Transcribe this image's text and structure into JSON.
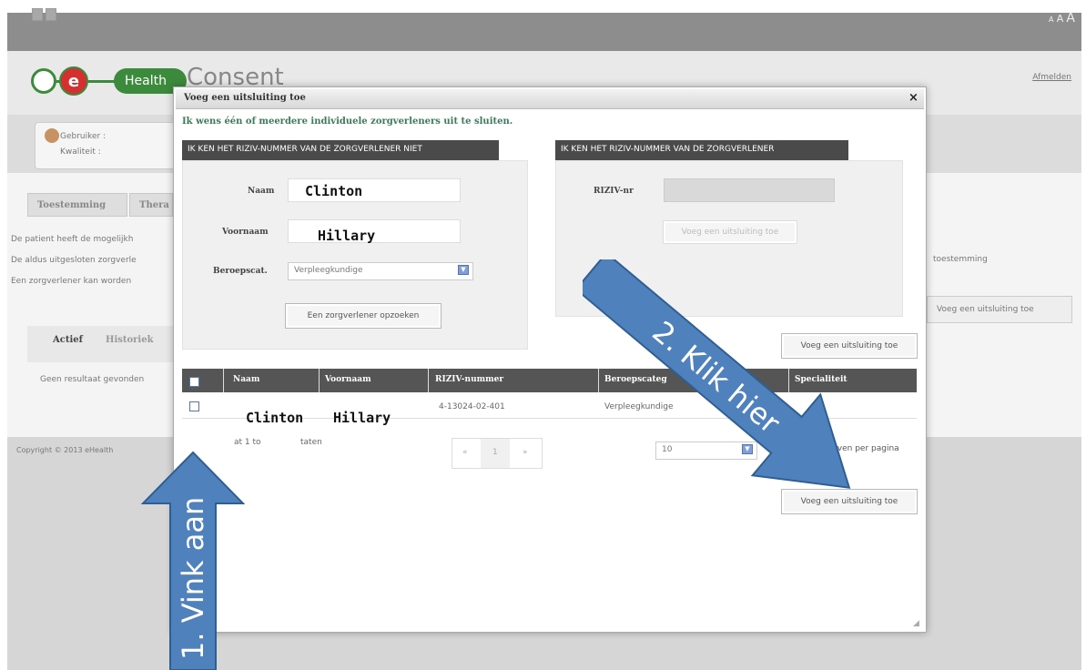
{
  "header": {
    "font_size_label": [
      "A",
      "A",
      "A"
    ],
    "logout_label": "Afmelden",
    "logo": {
      "e": "e",
      "health": "Health",
      "consent": "Consent"
    }
  },
  "user": {
    "line1": "Gebruiker :",
    "line2": "Kwaliteit :"
  },
  "main_tabs": [
    "Toestemming",
    "Thera"
  ],
  "info_lines": [
    "De patient heeft de mogelijkh",
    "De aldus uitgesloten zorgverle",
    "Een zorgverlener kan worden"
  ],
  "right_text": "toestemming",
  "bg_add_button": "Voeg een uitsluiting toe",
  "sub_tabs": [
    "Actief",
    "Historiek"
  ],
  "no_results": "Geen resultaat gevonden",
  "copyright": "Copyright © 2013 eHealth",
  "modal": {
    "title": "Voeg een uitsluiting toe",
    "close": "×",
    "subtitle": "Ik wens één of meerdere individuele zorgverleners uit te sluiten.",
    "left_panel": {
      "header": "IK KEN HET RIZIV-NUMMER VAN DE ZORGVERLENER NIET",
      "naam_label": "Naam",
      "naam_value": "Clinton",
      "voornaam_label": "Voornaam",
      "voornaam_value": "Hillary",
      "beroep_label": "Beroepscat.",
      "beroep_value": "Verpleegkundige",
      "search_button": "Een zorgverlener opzoeken"
    },
    "right_panel": {
      "header": "IK KEN HET RIZIV-NUMMER VAN DE ZORGVERLENER",
      "riziv_label": "RIZIV-nr",
      "riziv_value": "",
      "add_button": "Voeg een uitsluiting toe"
    },
    "add_button_top": "Voeg een uitsluiting toe",
    "table": {
      "headers": [
        "Naam",
        "Voornaam",
        "RIZIV-nummer",
        "Beroepscateg",
        "Specialiteit"
      ],
      "rows": [
        {
          "naam": "Clinton",
          "voornaam": "Hillary",
          "riziv": "4-13024-02-401",
          "beroep": "Verpleegkundige",
          "specialiteit": ""
        }
      ]
    },
    "footer": {
      "showing_prefix": "at 1 to",
      "showing_suffix": "taten",
      "pager_prev": "«",
      "pager_current": "1",
      "pager_next": "»",
      "per_page_value": "10",
      "per_page_label": "rgeven per pagina"
    },
    "add_button_bottom": "Voeg een uitsluiting toe"
  },
  "annotations": {
    "arrow1_text": "1. Vink aan",
    "arrow2_text": "2. Klik hier",
    "arrow_color": "#4f81bd"
  },
  "colors": {
    "accent_green": "#3c8a3c",
    "logo_red": "#d3302f",
    "table_header": "#555555",
    "subtitle_green": "#3b7a5a"
  }
}
